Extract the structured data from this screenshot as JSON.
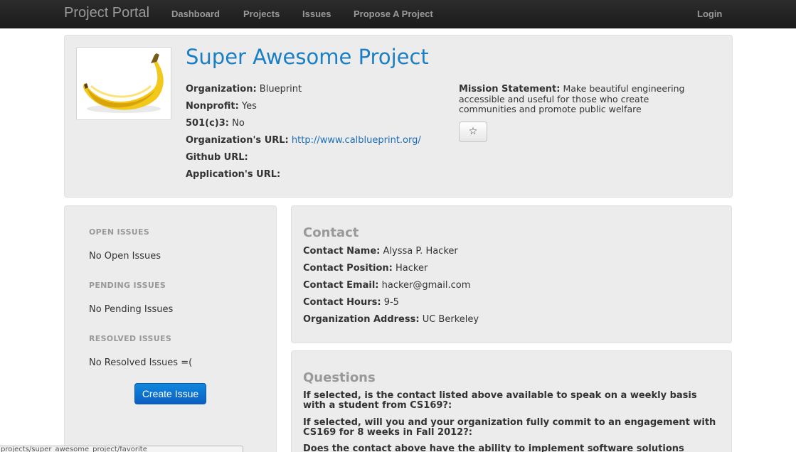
{
  "nav": {
    "brand": "Project Portal",
    "links": [
      "Dashboard",
      "Projects",
      "Issues",
      "Propose A Project"
    ],
    "login": "Login"
  },
  "project": {
    "title": "Super Awesome Project",
    "image_alt": "banana",
    "fields": [
      {
        "label": "Organization:",
        "value": "Blueprint"
      },
      {
        "label": "Nonprofit:",
        "value": "Yes"
      },
      {
        "label": "501(c)3:",
        "value": "No"
      },
      {
        "label": "Organization's URL:",
        "value": "http://www.calblueprint.org/"
      },
      {
        "label": "Github URL:",
        "value": ""
      },
      {
        "label": "Application's URL:",
        "value": ""
      }
    ],
    "mission_label": "Mission Statement:",
    "mission_text": "Make beautiful engineering accessible and useful for those who create communities and promote public welfare",
    "favorite_glyph": "☆"
  },
  "issues": {
    "open_head": "OPEN ISSUES",
    "open_text": "No Open Issues",
    "pending_head": "PENDING ISSUES",
    "pending_text": "No Pending Issues",
    "resolved_head": "RESOLVED ISSUES",
    "resolved_text": "No Resolved Issues =(",
    "create_label": "Create Issue"
  },
  "contact": {
    "heading": "Contact",
    "fields": [
      {
        "label": "Contact Name:",
        "value": "Alyssa P. Hacker"
      },
      {
        "label": "Contact Position:",
        "value": "Hacker"
      },
      {
        "label": "Contact Email:",
        "value": "hacker@gmail.com"
      },
      {
        "label": "Contact Hours:",
        "value": "9-5"
      },
      {
        "label": "Organization Address:",
        "value": "UC Berkeley"
      }
    ]
  },
  "questions": {
    "heading": "Questions",
    "items": [
      "If selected, is the contact listed above available to speak on a weekly basis with a student from CS169?:",
      "If selected, will you and your organization fully commit to an engagement with CS169 for 8 weeks in Fall 2012?:",
      "Does the contact above have the ability to implement software solutions"
    ]
  },
  "status_bar": "projects/super_awesome_project/favorite",
  "colors": {
    "navbar": "#1b1b1b",
    "title": "#1a7fc4",
    "link": "#1a6fb5",
    "well": "#ececec",
    "primary_button": "#0a5fc4"
  }
}
